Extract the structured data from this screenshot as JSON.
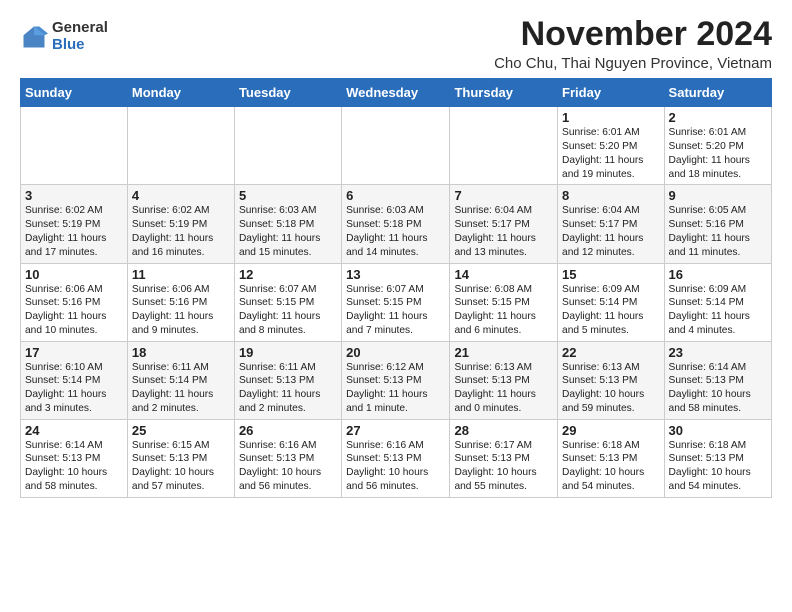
{
  "header": {
    "logo_general": "General",
    "logo_blue": "Blue",
    "month_title": "November 2024",
    "location": "Cho Chu, Thai Nguyen Province, Vietnam"
  },
  "days_of_week": [
    "Sunday",
    "Monday",
    "Tuesday",
    "Wednesday",
    "Thursday",
    "Friday",
    "Saturday"
  ],
  "weeks": [
    [
      {
        "day": "",
        "info": ""
      },
      {
        "day": "",
        "info": ""
      },
      {
        "day": "",
        "info": ""
      },
      {
        "day": "",
        "info": ""
      },
      {
        "day": "",
        "info": ""
      },
      {
        "day": "1",
        "info": "Sunrise: 6:01 AM\nSunset: 5:20 PM\nDaylight: 11 hours and 19 minutes."
      },
      {
        "day": "2",
        "info": "Sunrise: 6:01 AM\nSunset: 5:20 PM\nDaylight: 11 hours and 18 minutes."
      }
    ],
    [
      {
        "day": "3",
        "info": "Sunrise: 6:02 AM\nSunset: 5:19 PM\nDaylight: 11 hours and 17 minutes."
      },
      {
        "day": "4",
        "info": "Sunrise: 6:02 AM\nSunset: 5:19 PM\nDaylight: 11 hours and 16 minutes."
      },
      {
        "day": "5",
        "info": "Sunrise: 6:03 AM\nSunset: 5:18 PM\nDaylight: 11 hours and 15 minutes."
      },
      {
        "day": "6",
        "info": "Sunrise: 6:03 AM\nSunset: 5:18 PM\nDaylight: 11 hours and 14 minutes."
      },
      {
        "day": "7",
        "info": "Sunrise: 6:04 AM\nSunset: 5:17 PM\nDaylight: 11 hours and 13 minutes."
      },
      {
        "day": "8",
        "info": "Sunrise: 6:04 AM\nSunset: 5:17 PM\nDaylight: 11 hours and 12 minutes."
      },
      {
        "day": "9",
        "info": "Sunrise: 6:05 AM\nSunset: 5:16 PM\nDaylight: 11 hours and 11 minutes."
      }
    ],
    [
      {
        "day": "10",
        "info": "Sunrise: 6:06 AM\nSunset: 5:16 PM\nDaylight: 11 hours and 10 minutes."
      },
      {
        "day": "11",
        "info": "Sunrise: 6:06 AM\nSunset: 5:16 PM\nDaylight: 11 hours and 9 minutes."
      },
      {
        "day": "12",
        "info": "Sunrise: 6:07 AM\nSunset: 5:15 PM\nDaylight: 11 hours and 8 minutes."
      },
      {
        "day": "13",
        "info": "Sunrise: 6:07 AM\nSunset: 5:15 PM\nDaylight: 11 hours and 7 minutes."
      },
      {
        "day": "14",
        "info": "Sunrise: 6:08 AM\nSunset: 5:15 PM\nDaylight: 11 hours and 6 minutes."
      },
      {
        "day": "15",
        "info": "Sunrise: 6:09 AM\nSunset: 5:14 PM\nDaylight: 11 hours and 5 minutes."
      },
      {
        "day": "16",
        "info": "Sunrise: 6:09 AM\nSunset: 5:14 PM\nDaylight: 11 hours and 4 minutes."
      }
    ],
    [
      {
        "day": "17",
        "info": "Sunrise: 6:10 AM\nSunset: 5:14 PM\nDaylight: 11 hours and 3 minutes."
      },
      {
        "day": "18",
        "info": "Sunrise: 6:11 AM\nSunset: 5:14 PM\nDaylight: 11 hours and 2 minutes."
      },
      {
        "day": "19",
        "info": "Sunrise: 6:11 AM\nSunset: 5:13 PM\nDaylight: 11 hours and 2 minutes."
      },
      {
        "day": "20",
        "info": "Sunrise: 6:12 AM\nSunset: 5:13 PM\nDaylight: 11 hours and 1 minute."
      },
      {
        "day": "21",
        "info": "Sunrise: 6:13 AM\nSunset: 5:13 PM\nDaylight: 11 hours and 0 minutes."
      },
      {
        "day": "22",
        "info": "Sunrise: 6:13 AM\nSunset: 5:13 PM\nDaylight: 10 hours and 59 minutes."
      },
      {
        "day": "23",
        "info": "Sunrise: 6:14 AM\nSunset: 5:13 PM\nDaylight: 10 hours and 58 minutes."
      }
    ],
    [
      {
        "day": "24",
        "info": "Sunrise: 6:14 AM\nSunset: 5:13 PM\nDaylight: 10 hours and 58 minutes."
      },
      {
        "day": "25",
        "info": "Sunrise: 6:15 AM\nSunset: 5:13 PM\nDaylight: 10 hours and 57 minutes."
      },
      {
        "day": "26",
        "info": "Sunrise: 6:16 AM\nSunset: 5:13 PM\nDaylight: 10 hours and 56 minutes."
      },
      {
        "day": "27",
        "info": "Sunrise: 6:16 AM\nSunset: 5:13 PM\nDaylight: 10 hours and 56 minutes."
      },
      {
        "day": "28",
        "info": "Sunrise: 6:17 AM\nSunset: 5:13 PM\nDaylight: 10 hours and 55 minutes."
      },
      {
        "day": "29",
        "info": "Sunrise: 6:18 AM\nSunset: 5:13 PM\nDaylight: 10 hours and 54 minutes."
      },
      {
        "day": "30",
        "info": "Sunrise: 6:18 AM\nSunset: 5:13 PM\nDaylight: 10 hours and 54 minutes."
      }
    ]
  ]
}
